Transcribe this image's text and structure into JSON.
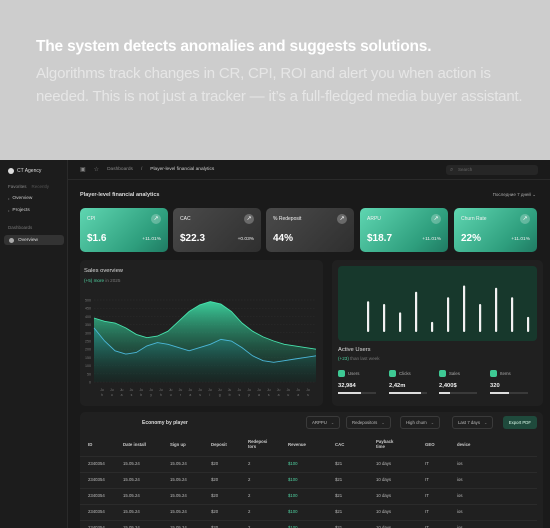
{
  "hero": {
    "title": "The system detects anomalies and suggests solutions.",
    "description": "Algorithms track changes in CR, CPI, ROI and alert you when action is needed. This is not just a tracker — it’s a full-fledged media buyer assistant."
  },
  "sidebar": {
    "org": "CT Agency",
    "tabs": [
      "Favorites",
      "Recently"
    ],
    "items": [
      {
        "label": "Overview"
      },
      {
        "label": "Projects"
      }
    ],
    "section": "Dashboards",
    "active": "Overview"
  },
  "topbar": {
    "crumbs": [
      "Dashboards",
      "Player-level financial analytics"
    ],
    "search_placeholder": "Search"
  },
  "page": {
    "title": "Player-level financial analytics",
    "period": "Последние 7 дней"
  },
  "kpis": [
    {
      "label": "CPI",
      "value": "$1.6",
      "change": "+11.01%",
      "style": "green"
    },
    {
      "label": "CAC",
      "value": "$22.3",
      "change": "+0.03%",
      "style": "gray"
    },
    {
      "label": "% Redeposit",
      "value": "44%",
      "change": "",
      "style": "gray"
    },
    {
      "label": "ARPU",
      "value": "$18.7",
      "change": "+11.01%",
      "style": "green"
    },
    {
      "label": "Churn Rate",
      "value": "22%",
      "change": "+11.01%",
      "style": "green"
    }
  ],
  "sales": {
    "title": "Sales overview",
    "highlight": "(+5) more",
    "subtitle_rest": " in 2025",
    "y_ticks": [
      "500",
      "450",
      "400",
      "350",
      "300",
      "250",
      "200",
      "150",
      "100",
      "50",
      "0"
    ],
    "x_ticks": [
      "Ju",
      "Ju",
      "Ju",
      "Ju",
      "Ju",
      "Ju",
      "Ju",
      "Ju",
      "Ju",
      "Ju",
      "Ju",
      "Ju",
      "Ju",
      "Ju",
      "Ju",
      "Ju",
      "Ju",
      "Ju",
      "Ju",
      "Ju",
      "Ju",
      "Ju"
    ],
    "x_ticks_2": [
      "h",
      "u",
      "a",
      "s",
      "b",
      "y",
      "h",
      "u",
      "r",
      "a",
      "s",
      "i",
      "g",
      "b",
      "s",
      "p",
      "a",
      "s",
      "a",
      "u",
      "a",
      "s"
    ]
  },
  "active_users": {
    "title": "Active Users",
    "highlight": "(+23)",
    "subtitle_rest": " than last week",
    "bars": [
      0.55,
      0.5,
      0.35,
      0.72,
      0.18,
      0.62,
      0.83,
      0.5,
      0.79,
      0.62,
      0.27
    ],
    "stats": [
      {
        "label": "Users",
        "value": "32,984",
        "fill": 0.6
      },
      {
        "label": "Clicks",
        "value": "2,42m",
        "fill": 0.85
      },
      {
        "label": "Sales",
        "value": "2,400$",
        "fill": 0.3
      },
      {
        "label": "Items",
        "value": "320",
        "fill": 0.5
      }
    ]
  },
  "economy": {
    "title": "Economy by player",
    "filters": [
      "ARPPU",
      "Redepositors",
      "High churn",
      "Last 7 days"
    ],
    "export_label": "Export PDF",
    "columns": [
      "ID",
      "Date install",
      "Sign up",
      "Deposit",
      "Redeposi tors",
      "Revenue",
      "CAC",
      "Payback time",
      "GEO",
      "device"
    ],
    "rows": [
      [
        "2340354",
        "15.05.24",
        "15.05.24",
        "$20",
        "2",
        "$100",
        "$21",
        "10 days",
        "IT",
        "ios"
      ],
      [
        "2340354",
        "15.05.24",
        "15.05.24",
        "$20",
        "2",
        "$100",
        "$21",
        "10 days",
        "IT",
        "ios"
      ],
      [
        "2340354",
        "15.05.24",
        "15.05.24",
        "$20",
        "2",
        "$100",
        "$21",
        "10 days",
        "IT",
        "ios"
      ],
      [
        "2340354",
        "15.05.24",
        "15.05.24",
        "$20",
        "2",
        "$100",
        "$21",
        "10 days",
        "IT",
        "ios"
      ],
      [
        "2340354",
        "15.05.24",
        "15.05.24",
        "$20",
        "2",
        "$100",
        "$21",
        "10 days",
        "IT",
        "ios"
      ]
    ]
  },
  "colors": {
    "accent": "#3ec994",
    "kpi_green": "#4cc7a2",
    "panel": "#202020",
    "bg": "#1a1a1a"
  },
  "icons": {
    "arrow": "arrow-up-right-icon",
    "search": "search-icon",
    "star": "star-icon",
    "sidebar": "sidebar-toggle-icon"
  }
}
